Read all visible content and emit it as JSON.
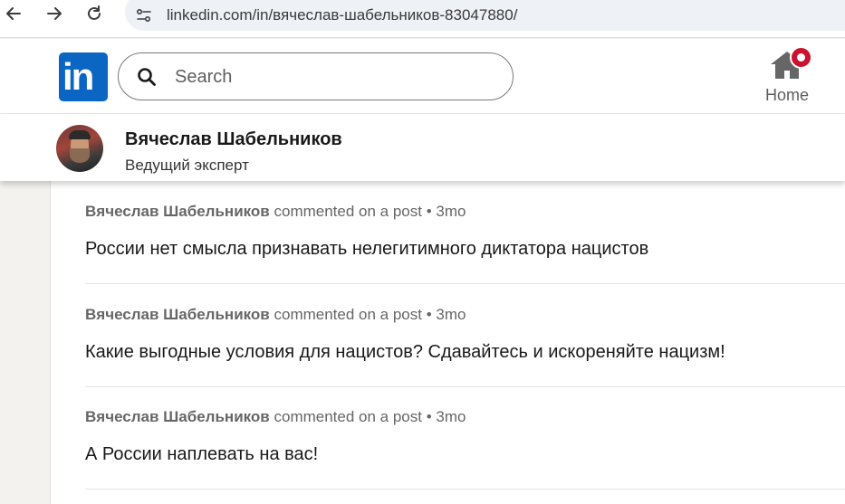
{
  "browser": {
    "url": "linkedin.com/in/вячеслав-шабельников-83047880/"
  },
  "header": {
    "logo_text": "in",
    "search": {
      "placeholder": "Search"
    },
    "home_label": "Home",
    "brand_color": "#0a66c2",
    "badge_color": "#cb112d"
  },
  "profile": {
    "name": "Вячеслав Шабельников",
    "title": "Ведущий эксперт"
  },
  "activity": [
    {
      "author": "Вячеслав Шабельников",
      "action": "commented on a post",
      "separator": "•",
      "time": "3mo",
      "text": "России нет смысла признавать нелегитимного диктатора нацистов"
    },
    {
      "author": "Вячеслав Шабельников",
      "action": "commented on a post",
      "separator": "•",
      "time": "3mo",
      "text": "Какие выгодные условия для нацистов? Сдавайтесь и искореняйте нацизм!"
    },
    {
      "author": "Вячеслав Шабельников",
      "action": "commented on a post",
      "separator": "•",
      "time": "3mo",
      "text": "А России наплевать на вас!"
    }
  ]
}
